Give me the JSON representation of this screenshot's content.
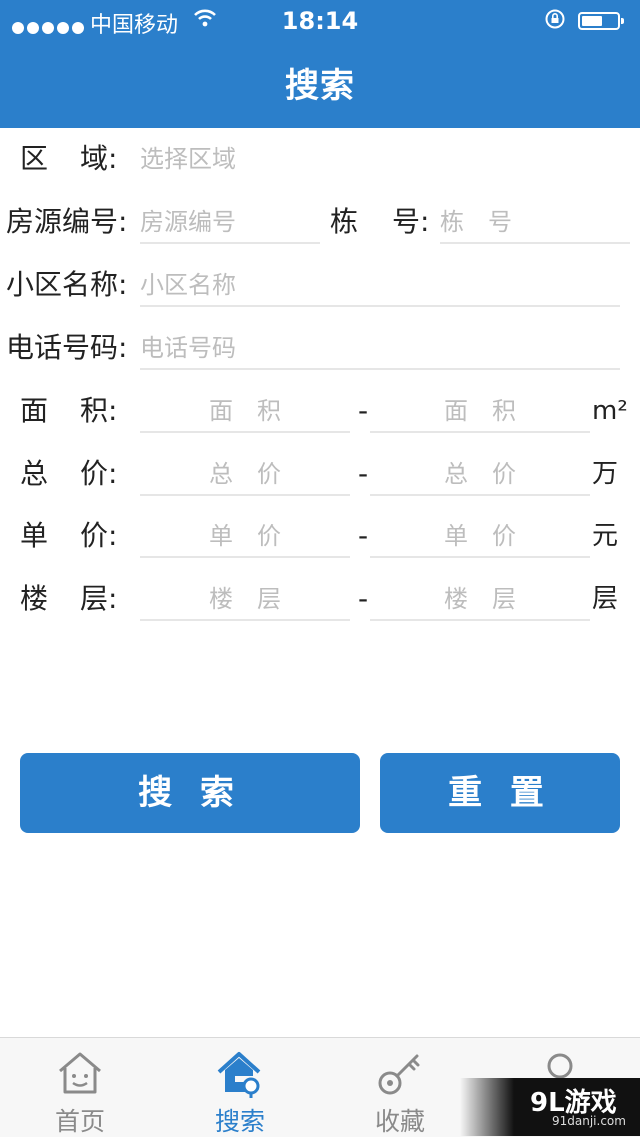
{
  "status_bar": {
    "carrier": "中国移动",
    "time": "18:14"
  },
  "nav": {
    "title": "搜索"
  },
  "form": {
    "area": {
      "label_a": "区",
      "label_b": "域:",
      "placeholder": "选择区域"
    },
    "house_code": {
      "label": "房源编号:",
      "placeholder": "房源编号"
    },
    "building": {
      "label_a": "栋",
      "label_b": "号:",
      "placeholder": "栋　号"
    },
    "community": {
      "label": "小区名称:",
      "placeholder": "小区名称"
    },
    "phone": {
      "label": "电话号码:",
      "placeholder": "电话号码"
    },
    "ranges": [
      {
        "label_a": "面",
        "label_b": "积:",
        "min_placeholder": "面　积",
        "max_placeholder": "面　积",
        "unit": "m²"
      },
      {
        "label_a": "总",
        "label_b": "价:",
        "min_placeholder": "总　价",
        "max_placeholder": "总　价",
        "unit": "万"
      },
      {
        "label_a": "单",
        "label_b": "价:",
        "min_placeholder": "单　价",
        "max_placeholder": "单　价",
        "unit": "元"
      },
      {
        "label_a": "楼",
        "label_b": "层:",
        "min_placeholder": "楼　层",
        "max_placeholder": "楼　层",
        "unit": "层"
      }
    ],
    "range_separator": "-"
  },
  "buttons": {
    "search": "搜 索",
    "reset": "重 置"
  },
  "tabbar": {
    "items": [
      {
        "label": "首页",
        "icon": "home-icon"
      },
      {
        "label": "搜索",
        "icon": "search-house-icon"
      },
      {
        "label": "收藏",
        "icon": "key-icon"
      },
      {
        "label": "",
        "icon": "user-icon"
      }
    ],
    "active_index": 1
  },
  "watermark": {
    "brand": "9L游戏",
    "site": "91danji.com"
  },
  "colors": {
    "primary": "#2b7fcb",
    "placeholder": "#bdbdbd",
    "divider": "#e6e6e6"
  }
}
